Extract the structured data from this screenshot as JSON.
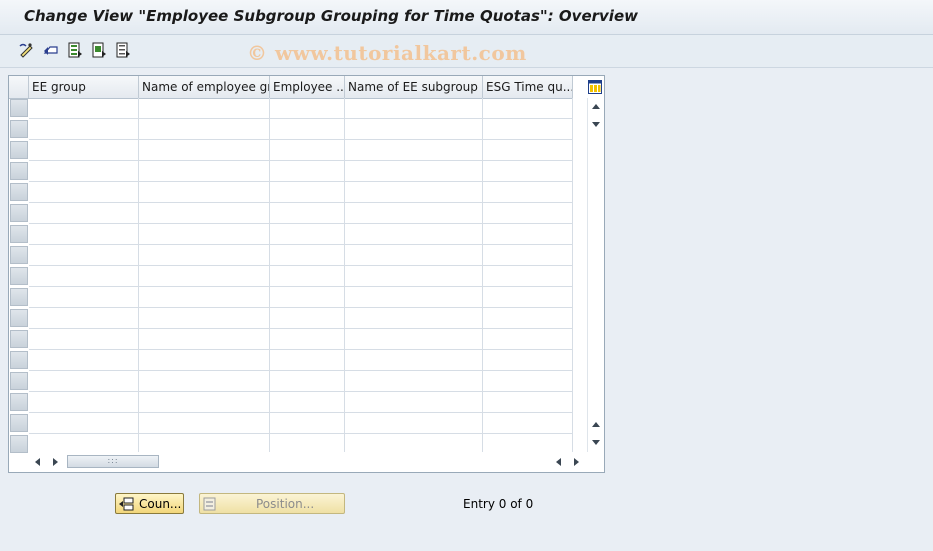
{
  "window": {
    "title": "Change View \"Employee Subgroup Grouping for Time Quotas\": Overview"
  },
  "toolbar": {
    "icons": [
      "change-display-icon",
      "undo-icon",
      "select-all-icon",
      "select-block-icon",
      "deselect-all-icon"
    ]
  },
  "watermark": {
    "text": "© www.tutorialkart.com",
    "color": "#f1c79e"
  },
  "table": {
    "columns": [
      {
        "label": "EE group"
      },
      {
        "label": "Name of employee grp"
      },
      {
        "label": "Employee ..."
      },
      {
        "label": "Name of EE subgroup"
      },
      {
        "label": "ESG Time qu..."
      }
    ],
    "visible_rows": 17
  },
  "buttons": {
    "count_label": "Coun...",
    "position_label": "Position..."
  },
  "status": {
    "entry_text": "Entry 0 of 0"
  },
  "colors": {
    "background": "#e9eef4",
    "button_yellow": "#f2d67a",
    "grid_border": "#99a9b8"
  }
}
